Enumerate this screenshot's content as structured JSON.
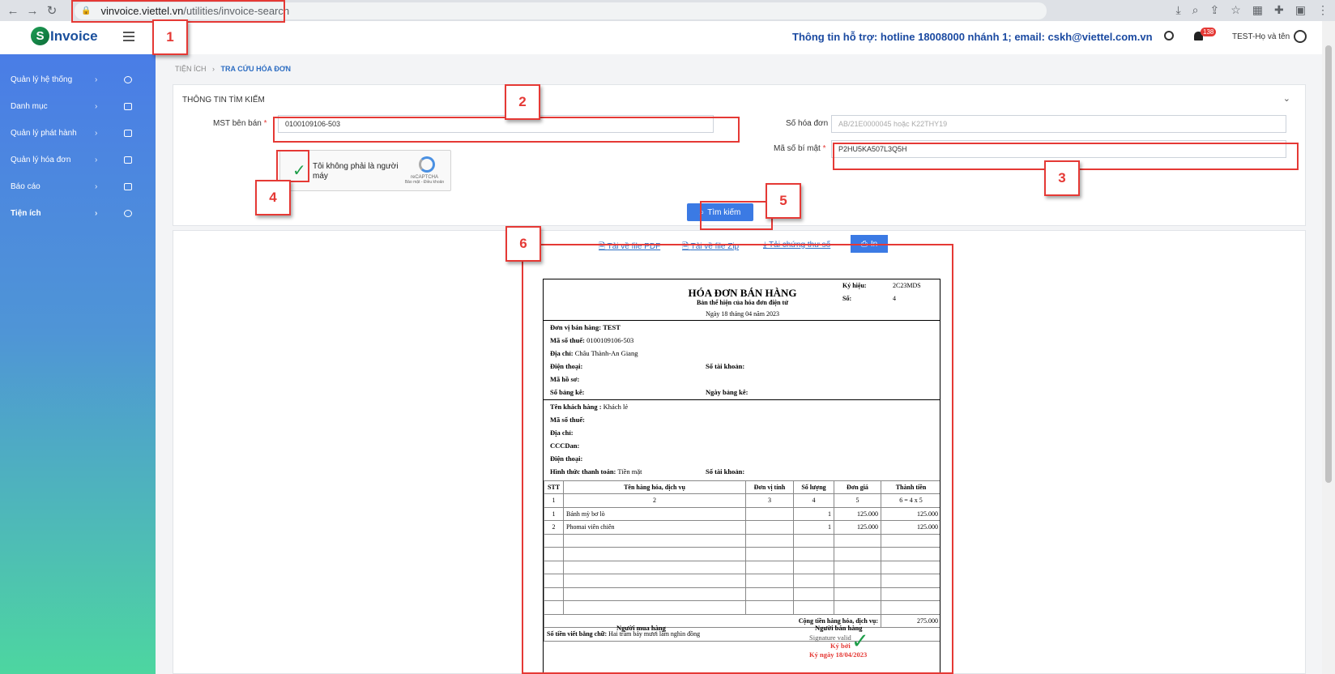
{
  "browser": {
    "url_domain": "vinvoice.viettel.vn",
    "url_path": "/utilities/invoice-search"
  },
  "header": {
    "logo_s": "S",
    "logo_text": "Invoice",
    "support": "Thông tin hỗ trợ: hotline 18008000 nhánh 1; email: cskh@viettel.com.vn",
    "badge_count": "138",
    "user": "TEST-Họ và tên"
  },
  "sidebar": {
    "items": [
      {
        "label": "Quản lý hệ thống"
      },
      {
        "label": "Danh mục"
      },
      {
        "label": "Quản lý phát hành"
      },
      {
        "label": "Quản lý hóa đơn"
      },
      {
        "label": "Báo cáo"
      },
      {
        "label": "Tiện ích"
      }
    ]
  },
  "breadcrumb": {
    "root": "TIỆN ÍCH",
    "sep": "›",
    "current": "TRA CỨU HÓA ĐƠN"
  },
  "search": {
    "panel_title": "THÔNG TIN TÌM KIẾM",
    "mst_label": "MST bên bán",
    "mst_value": "0100109106-503",
    "so_hd_label": "Số hóa đơn",
    "so_hd_placeholder": "AB/21E0000045 hoặc K22THY19",
    "ma_bm_label": "Mã số bí mật",
    "ma_bm_value": "P2HU5KA507L3Q5H",
    "captcha_text": "Tôi không phải là người máy",
    "captcha_brand": "reCAPTCHA",
    "captcha_terms": "Bảo mật - Điều khoản",
    "search_button": "Tìm kiếm"
  },
  "actions": {
    "pdf": "Tải về file PDF",
    "zip": "Tải về file Zip",
    "cert": "Tải chứng thư số",
    "print": "In"
  },
  "invoice": {
    "title": "HÓA ĐƠN BÁN HÀNG",
    "subtitle": "Bản thể hiện của hóa đơn điện tử",
    "date": "Ngày 18 tháng 04 năm 2023",
    "ky_hieu_label": "Ký hiệu:",
    "ky_hieu": "2C23MDS",
    "so_label": "Số:",
    "so": "4",
    "seller_label": "Đơn vị bán hàng:",
    "seller": "TEST",
    "mst_label": "Mã số thuế:",
    "mst": "0100109106-503",
    "address_label": "Địa chỉ:",
    "address": "Châu Thành-An Giang",
    "phone_label": "Điện thoại:",
    "account_label": "Số tài khoản:",
    "ma_ho_so_label": "Mã hồ sơ:",
    "so_bang_ke_label": "Số bảng kê:",
    "ngay_bang_ke_label": "Ngày bảng kê:",
    "buyer_label": "Tên khách hàng :",
    "buyer": "Khách lẻ",
    "buyer_mst_label": "Mã số thuế:",
    "buyer_addr_label": "Địa chỉ:",
    "cccd_label": "CCCDan:",
    "buyer_phone_label": "Điện thoại:",
    "payment_label": "Hình thức thanh toán:",
    "payment": "Tiền mặt",
    "buyer_account_label": "Số tài khoản:",
    "table_headers": [
      "STT",
      "Tên hàng hóa, dịch vụ",
      "Đơn vị tính",
      "Số lượng",
      "Đơn giá",
      "Thành tiền"
    ],
    "col_numbers": [
      "1",
      "2",
      "3",
      "4",
      "5",
      "6 = 4 x 5"
    ],
    "rows": [
      {
        "stt": "1",
        "name": "Bánh mỳ bơ lò",
        "unit": "",
        "qty": "1",
        "price": "125.000",
        "total": "125.000"
      },
      {
        "stt": "2",
        "name": "Phomai viên chiên",
        "unit": "",
        "qty": "1",
        "price": "125.000",
        "total": "125.000"
      }
    ],
    "sum_label": "Cộng tiền hàng hóa, dịch vụ:",
    "sum": "275.000",
    "in_words_label": "Số tiền viết bằng chữ:",
    "in_words": "Hai trăm bảy mươi lăm nghìn đồng",
    "buyer_sign": "Người mua hàng",
    "seller_sign": "Người bán hàng",
    "sig_valid": "Signature valid",
    "signed_by": "Ký bởi",
    "signed_date": "Ký ngày 18/04/2023"
  },
  "annotations": [
    "1",
    "2",
    "3",
    "4",
    "5",
    "6"
  ],
  "colors": {
    "accent": "#3b7ae4",
    "annotation": "#e53935",
    "brand": "#1b4aa1"
  }
}
